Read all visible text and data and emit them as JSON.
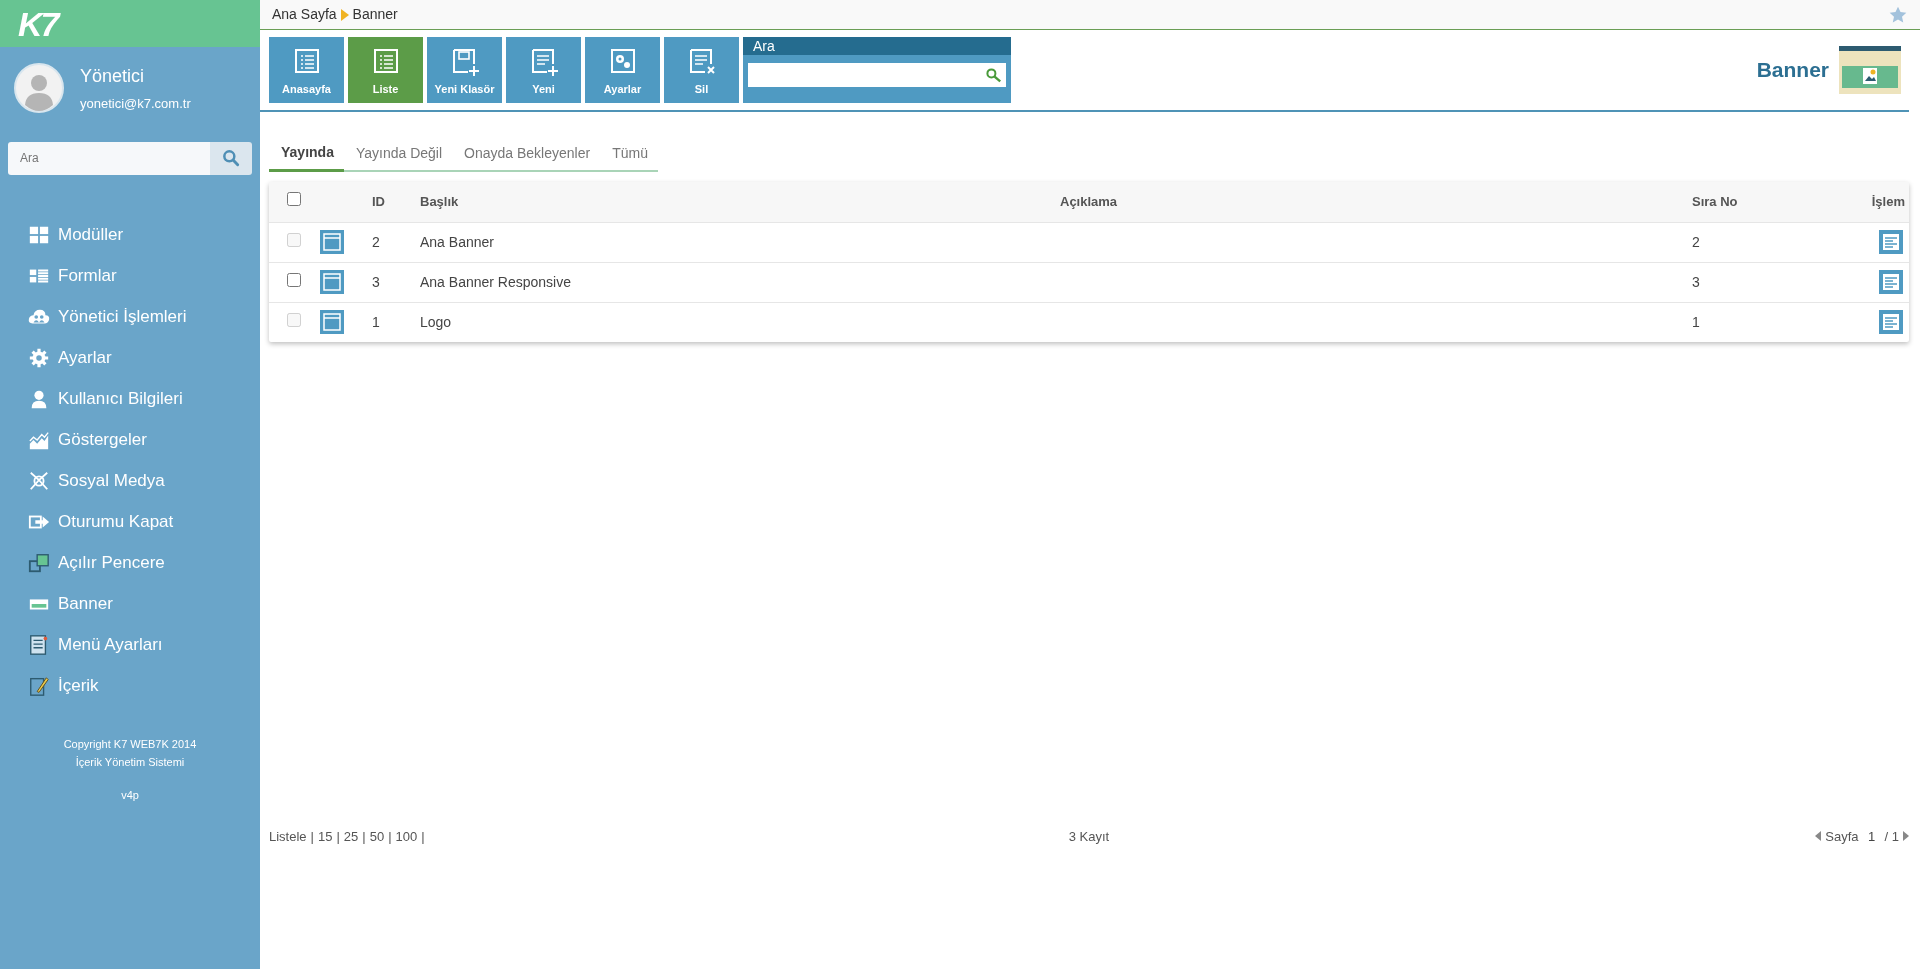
{
  "sidebar": {
    "logo": "K7",
    "user": {
      "name": "Yönetici",
      "email": "yonetici@k7.com.tr"
    },
    "search": {
      "placeholder": "Ara"
    },
    "items": [
      {
        "label": "Modüller"
      },
      {
        "label": "Formlar"
      },
      {
        "label": "Yönetici İşlemleri"
      },
      {
        "label": "Ayarlar"
      },
      {
        "label": "Kullanıcı Bilgileri"
      },
      {
        "label": "Göstergeler"
      },
      {
        "label": "Sosyal Medya"
      },
      {
        "label": "Oturumu Kapat"
      },
      {
        "label": "Açılır Pencere"
      },
      {
        "label": "Banner"
      },
      {
        "label": "Menü Ayarları"
      },
      {
        "label": "İçerik"
      }
    ],
    "copyright": [
      "Copyright K7 WEB7K 2014",
      "İçerik Yönetim Sistemi"
    ],
    "version": "v4p"
  },
  "breadcrumb": [
    "Ana Sayfa",
    "Banner"
  ],
  "toolbar": {
    "buttons": [
      {
        "label": "Anasayfa",
        "selected": false
      },
      {
        "label": "Liste",
        "selected": true
      },
      {
        "label": "Yeni Klasör",
        "selected": false
      },
      {
        "label": "Yeni",
        "selected": false
      },
      {
        "label": "Ayarlar",
        "selected": false
      },
      {
        "label": "Sil",
        "selected": false
      }
    ],
    "search": {
      "title": "Ara"
    }
  },
  "page_title": "Banner",
  "tabs": [
    {
      "label": "Yayında",
      "selected": true
    },
    {
      "label": "Yayında Değil",
      "selected": false
    },
    {
      "label": "Onayda Bekleyenler",
      "selected": false
    },
    {
      "label": "Tümü",
      "selected": false
    }
  ],
  "table": {
    "select_all": {
      "checked": false
    },
    "columns": [
      "ID",
      "Başlık",
      "Açıklama",
      "Sıra No",
      "İşlem"
    ],
    "rows": [
      {
        "checked": false,
        "disabled": true,
        "id": "2",
        "title": "Ana Banner",
        "order": "2"
      },
      {
        "checked": false,
        "disabled": false,
        "id": "3",
        "title": "Ana Banner Responsive",
        "order": "3"
      },
      {
        "checked": false,
        "disabled": true,
        "id": "1",
        "title": "Logo",
        "order": "1"
      }
    ]
  },
  "footer": {
    "list_label": "Listele",
    "page_sizes": [
      {
        "label": "15",
        "separator": "|"
      },
      {
        "label": "25",
        "separator": "|"
      },
      {
        "label": "50",
        "separator": "|"
      },
      {
        "label": "100",
        "separator": "|"
      }
    ],
    "first_separator": "|",
    "count": "3 Kayıt",
    "page_label": "Sayfa",
    "page": "1",
    "total": "/ 1"
  }
}
